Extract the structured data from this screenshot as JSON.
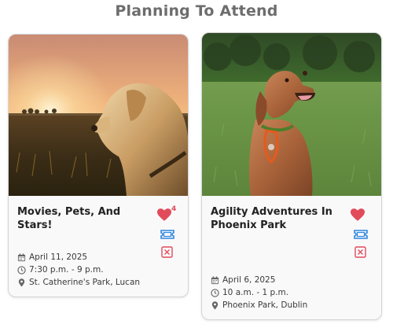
{
  "section": {
    "title": "Planning To Attend"
  },
  "events": [
    {
      "title": "Movies, Pets, And Stars!",
      "likes": "4",
      "date": "April 11, 2025",
      "time": "7:30 p.m. - 9 p.m.",
      "location": "St. Catherine's Park, Lucan",
      "image": "golden-retriever-sunset"
    },
    {
      "title": "Agility Adventures In Phoenix Park",
      "likes": "",
      "date": "April 6, 2025",
      "time": "10 a.m. - 1 p.m.",
      "location": "Phoenix Park, Dublin",
      "image": "red-dog-in-grass"
    }
  ],
  "icons": {
    "like": "heart-icon",
    "ticket": "ticket-icon",
    "remove": "close-box-icon",
    "date": "calendar-icon",
    "time": "clock-icon",
    "location": "map-pin-icon"
  },
  "colors": {
    "heart": "#e14b5a",
    "ticket": "#2f86e0",
    "remove": "#e14b5a",
    "title_muted": "#6d6d6d"
  }
}
